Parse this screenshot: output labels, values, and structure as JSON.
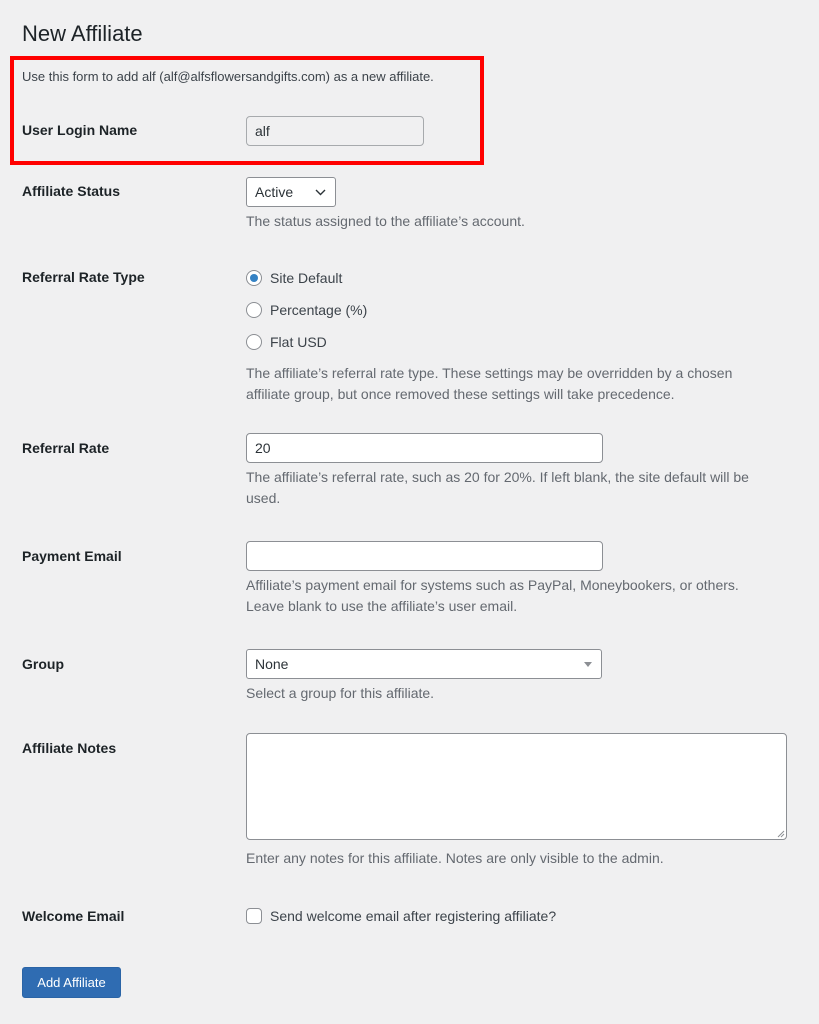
{
  "page": {
    "title": "New Affiliate",
    "intro": "Use this form to add alf (alf@alfsflowersandgifts.com) as a new affiliate.",
    "highlight_color": "#ff0000"
  },
  "form": {
    "user_login": {
      "label": "User Login Name",
      "value": "alf",
      "disabled": true
    },
    "status": {
      "label": "Affiliate Status",
      "selected": "Active",
      "description": "The status assigned to the affiliate’s account."
    },
    "rate_type": {
      "label": "Referral Rate Type",
      "options": [
        {
          "label": "Site Default",
          "checked": true
        },
        {
          "label": "Percentage (%)",
          "checked": false
        },
        {
          "label": "Flat USD",
          "checked": false
        }
      ],
      "description_line1": "The affiliate’s referral rate type. These settings may be overridden by a chosen",
      "description_line2": "affiliate group, but once removed these settings will take precedence."
    },
    "rate": {
      "label": "Referral Rate",
      "value": "20",
      "description_line1": "The affiliate’s referral rate, such as 20 for 20%. If left blank, the site default will be",
      "description_line2": "used."
    },
    "payment_email": {
      "label": "Payment Email",
      "value": "",
      "description_line1": "Affiliate’s payment email for systems such as PayPal, Moneybookers, or others.",
      "description_line2": "Leave blank to use the affiliate’s user email."
    },
    "group": {
      "label": "Group",
      "selected": "None",
      "description": "Select a group for this affiliate."
    },
    "notes": {
      "label": "Affiliate Notes",
      "value": "",
      "description": "Enter any notes for this affiliate. Notes are only visible to the admin."
    },
    "welcome_email": {
      "label": "Welcome Email",
      "checkbox_label": "Send welcome email after registering affiliate?",
      "checked": false
    },
    "submit_label": "Add Affiliate",
    "accent_color": "#2271b1"
  }
}
